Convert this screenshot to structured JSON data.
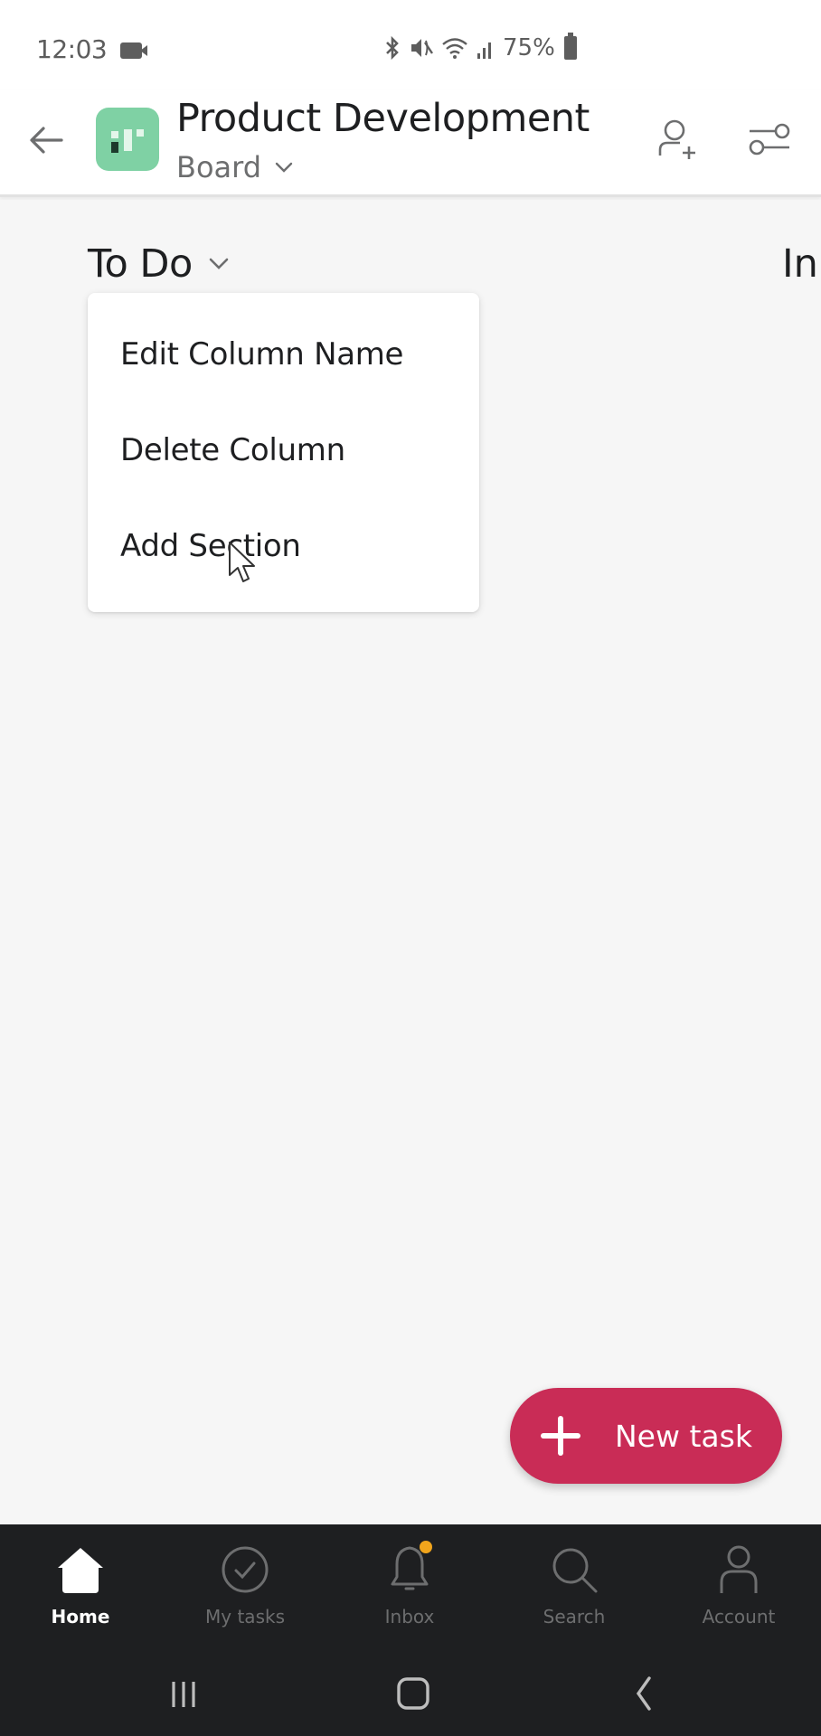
{
  "status_bar": {
    "time": "12:03",
    "battery": "75%",
    "icons": [
      "screen-record-icon",
      "bluetooth-icon",
      "mute-icon",
      "wifi-icon",
      "signal-icon",
      "battery-icon"
    ]
  },
  "header": {
    "project_title": "Product Development",
    "view_label": "Board",
    "app_icon_color": "#7fd1a4"
  },
  "board": {
    "columns": [
      {
        "title": "To Do"
      },
      {
        "title": "In"
      }
    ]
  },
  "column_menu": {
    "items": [
      {
        "label": "Edit Column Name"
      },
      {
        "label": "Delete Column"
      },
      {
        "label": "Add Section"
      }
    ]
  },
  "fab": {
    "label": "New task",
    "color": "#c92c56"
  },
  "bottom_nav": {
    "items": [
      {
        "label": "Home",
        "icon": "home-icon",
        "active": true
      },
      {
        "label": "My tasks",
        "icon": "check-circle-icon",
        "active": false
      },
      {
        "label": "Inbox",
        "icon": "bell-icon",
        "active": false,
        "badge": true
      },
      {
        "label": "Search",
        "icon": "search-icon",
        "active": false
      },
      {
        "label": "Account",
        "icon": "person-icon",
        "active": false
      }
    ],
    "badge_color": "#f1a51c"
  }
}
